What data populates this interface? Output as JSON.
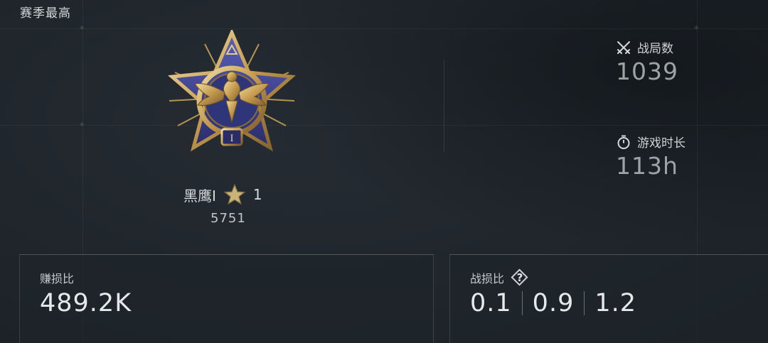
{
  "header": {
    "title": "赛季最高"
  },
  "rank": {
    "name": "黑鹰I",
    "star_count": "1",
    "points": "5751"
  },
  "stats": {
    "matches": {
      "label": "战局数",
      "value": "1039",
      "icon": "crossed-swords-icon"
    },
    "playtime": {
      "label": "游戏时长",
      "value": "113h",
      "icon": "stopwatch-icon"
    }
  },
  "cards": {
    "profit": {
      "label": "赚损比",
      "value": "489.2K"
    },
    "kd": {
      "label": "战损比",
      "help_icon": "question-diamond-icon",
      "values": [
        "0.1",
        "0.9",
        "1.2"
      ]
    }
  },
  "colors": {
    "background": "#1e2329",
    "medal_gold": "#c9a85a",
    "medal_blue": "#3b3f8a",
    "text_primary": "#e6e8ea",
    "text_muted": "#9ea3a8"
  }
}
